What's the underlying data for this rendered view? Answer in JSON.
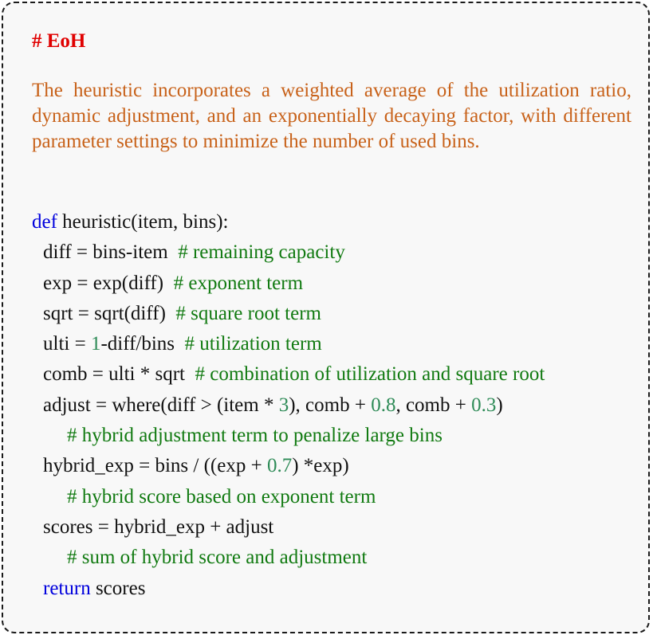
{
  "title": "# EoH",
  "description": "The heuristic incorporates a weighted average of the utilization ratio, dynamic adjustment, and an exponentially decaying factor, with different parameter settings to minimize the number of used bins.",
  "code": {
    "line1": {
      "kw": "def",
      "text": " heuristic(item, bins):"
    },
    "line2": {
      "text": "diff = bins-item  ",
      "comment": "# remaining capacity"
    },
    "line3": {
      "text": "exp = exp(diff)  ",
      "comment": "# exponent term"
    },
    "line4": {
      "text": "sqrt = sqrt(diff)  ",
      "comment": "# square root term"
    },
    "line5": {
      "pre": "ulti = ",
      "num": "1",
      "post": "-diff/bins  ",
      "comment": "# utilization term"
    },
    "line6": {
      "text": "comb = ulti * sqrt  ",
      "comment": "# combination of utilization and square root"
    },
    "line7": {
      "a": "adjust = where(diff > (item * ",
      "n1": "3",
      "b": "), comb + ",
      "n2": "0.8",
      "c": ", comb + ",
      "n3": "0.3",
      "d": ")"
    },
    "line8": {
      "comment": "# hybrid adjustment term to penalize large bins"
    },
    "line9": {
      "a": "hybrid_exp = bins / ((exp + ",
      "n1": "0.7",
      "b": ") *exp)"
    },
    "line10": {
      "comment": "# hybrid score based on exponent term"
    },
    "line11": {
      "text": "scores = hybrid_exp + adjust"
    },
    "line12": {
      "comment": "# sum of hybrid score and adjustment"
    },
    "line13": {
      "kw": "return",
      "text": " scores"
    }
  },
  "colors": {
    "title": "#e00000",
    "description": "#c8621a",
    "keyword": "#0000dd",
    "number": "#2e8b57",
    "comment": "#117a11",
    "code_text": "#111111",
    "background": "#f8f8f8",
    "border": "#1a1a1a"
  }
}
